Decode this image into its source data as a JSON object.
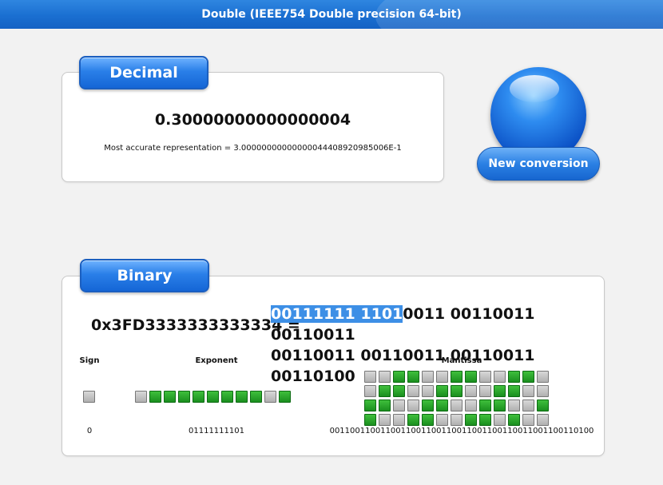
{
  "window": {
    "title": "Double (IEEE754 Double precision 64-bit)"
  },
  "decimal": {
    "label": "Decimal",
    "value": "0.30000000000000004",
    "accurate": "Most accurate representation = 3.00000000000000044408920985006E-1"
  },
  "new_conversion": {
    "label": "New conversion"
  },
  "binary": {
    "label": "Binary",
    "hex": "0x3FD3333333333334 =",
    "line1_selected": "00111111 1101",
    "line1_rest": "0011 00110011 00110011",
    "line2": "00110011 00110011 00110011 00110100",
    "sign_label": "Sign",
    "exponent_label": "Exponent",
    "mantissa_label": "Mantissa",
    "sign_value": "0",
    "exponent_value": "01111111101",
    "mantissa_value": "0011001100110011001100110011001100110011001100110100"
  },
  "colors": {
    "bit_on": "#1a8f1e",
    "bit_off": "#b0b0b0",
    "accent": "#1a6fd1"
  }
}
